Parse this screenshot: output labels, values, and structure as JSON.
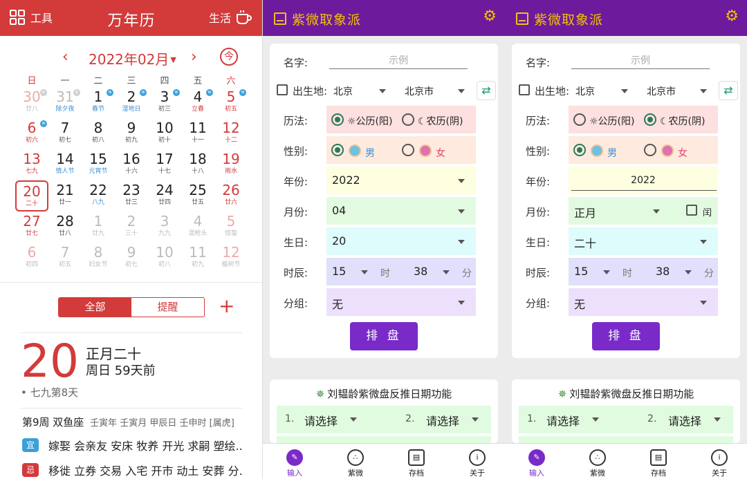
{
  "calendar": {
    "top": {
      "tool_label": "工具",
      "title": "万年历",
      "life_label": "生活"
    },
    "month_label": "2022年02月",
    "today_label": "今",
    "weekdays": [
      "日",
      "一",
      "二",
      "三",
      "四",
      "五",
      "六"
    ],
    "days": [
      {
        "n": "30",
        "l": "廿八",
        "fade": true,
        "red": true,
        "badge": "休",
        "bgrey": true
      },
      {
        "n": "31",
        "l": "除夕夜",
        "fade": true,
        "lb": true,
        "badge": "休",
        "bgrey": true
      },
      {
        "n": "1",
        "l": "春节",
        "lb": true,
        "badge": "休"
      },
      {
        "n": "2",
        "l": "湿地日",
        "lb": true,
        "badge": "休"
      },
      {
        "n": "3",
        "l": "初三",
        "badge": "休"
      },
      {
        "n": "4",
        "l": "立春",
        "lr": true,
        "badge": "休"
      },
      {
        "n": "5",
        "l": "初五",
        "red": true,
        "badge": "休"
      },
      {
        "n": "6",
        "l": "初六",
        "red": true,
        "badge": "休"
      },
      {
        "n": "7",
        "l": "初七"
      },
      {
        "n": "8",
        "l": "初八"
      },
      {
        "n": "9",
        "l": "初九"
      },
      {
        "n": "10",
        "l": "初十"
      },
      {
        "n": "11",
        "l": "十一"
      },
      {
        "n": "12",
        "l": "十二",
        "red": true
      },
      {
        "n": "13",
        "l": "七九",
        "red": true
      },
      {
        "n": "14",
        "l": "情人节",
        "lb": true
      },
      {
        "n": "15",
        "l": "元宵节",
        "lb": true
      },
      {
        "n": "16",
        "l": "十六"
      },
      {
        "n": "17",
        "l": "十七"
      },
      {
        "n": "18",
        "l": "十八"
      },
      {
        "n": "19",
        "l": "雨水",
        "red": true
      },
      {
        "n": "20",
        "l": "二十",
        "red": true,
        "sel": true
      },
      {
        "n": "21",
        "l": "廿一"
      },
      {
        "n": "22",
        "l": "八九",
        "lb": true
      },
      {
        "n": "23",
        "l": "廿三"
      },
      {
        "n": "24",
        "l": "廿四"
      },
      {
        "n": "25",
        "l": "廿五"
      },
      {
        "n": "26",
        "l": "廿六",
        "red": true
      },
      {
        "n": "27",
        "l": "廿七",
        "red": true
      },
      {
        "n": "28",
        "l": "廿八"
      },
      {
        "n": "1",
        "l": "廿九",
        "fade": true
      },
      {
        "n": "2",
        "l": "三十",
        "fade": true
      },
      {
        "n": "3",
        "l": "九九",
        "fade": true
      },
      {
        "n": "4",
        "l": "混枪头",
        "fade": true
      },
      {
        "n": "5",
        "l": "惊蛰",
        "fade": true,
        "red": true
      },
      {
        "n": "6",
        "l": "初四",
        "fade": true,
        "red": true
      },
      {
        "n": "7",
        "l": "初五",
        "fade": true
      },
      {
        "n": "8",
        "l": "妇女节",
        "fade": true
      },
      {
        "n": "9",
        "l": "初七",
        "fade": true
      },
      {
        "n": "10",
        "l": "初八",
        "fade": true
      },
      {
        "n": "11",
        "l": "初九",
        "fade": true
      },
      {
        "n": "12",
        "l": "植树节",
        "fade": true,
        "red": true
      }
    ],
    "segment": {
      "all": "全部",
      "remind": "提醒"
    },
    "plus": "+",
    "big_day": "20",
    "lunar_date": "正月二十",
    "weekday_ago": "周日 59天前",
    "jiu": "• 七九第8天",
    "week_info": "第9周 双鱼座",
    "ganzhi": "壬寅年 壬寅月 甲辰日 壬申时 [属虎]",
    "yi_tag": "宜",
    "yi_text": "嫁娶 会亲友 安床 牧养 开光 求嗣 塑绘...",
    "ji_tag": "忌",
    "ji_text": "移徙 立券 交易 入宅 开市 动土 安葬 分..."
  },
  "zw": [
    {
      "app_name": "紫微取象派",
      "gear_icon": "⚙",
      "labels": {
        "name": "名字:",
        "birthplace": "出生地:",
        "calendar": "历法:",
        "gender": "性别:",
        "year": "年份:",
        "month": "月份:",
        "day": "生日:",
        "hour": "时辰:",
        "group": "分组:"
      },
      "name_placeholder": "示例",
      "province": "北京",
      "city": "北京市",
      "solar": "☼公历(阳)",
      "lunar": "☾农历(阴)",
      "male": "男",
      "female": "女",
      "year": "2022",
      "month": "04",
      "leap": "",
      "day": "20",
      "hour": "15",
      "hour_unit": "时",
      "minute": "38",
      "minute_unit": "分",
      "group": "无",
      "submit": "排 盘",
      "reverse_title": "刘韫龄紫微盘反推日期功能",
      "pick_n1": "1.",
      "pick_s1": "请选择",
      "pick_n2": "2.",
      "pick_s2": "请选择",
      "nav": [
        "输入",
        "紫微",
        "存档",
        "关于"
      ]
    },
    {
      "app_name": "紫微取象派",
      "gear_icon": "⚙",
      "labels": {
        "name": "名字:",
        "birthplace": "出生地:",
        "calendar": "历法:",
        "gender": "性别:",
        "year": "年份:",
        "month": "月份:",
        "day": "生日:",
        "hour": "时辰:",
        "group": "分组:"
      },
      "name_placeholder": "示例",
      "province": "北京",
      "city": "北京市",
      "solar": "☼公历(阳)",
      "lunar": "☾农历(阴)",
      "male": "男",
      "female": "女",
      "year": "2022",
      "month": "正月",
      "leap": "闰",
      "day": "二十",
      "hour": "15",
      "hour_unit": "时",
      "minute": "38",
      "minute_unit": "分",
      "group": "无",
      "submit": "排 盘",
      "reverse_title": "刘韫龄紫微盘反推日期功能",
      "pick_n1": "1.",
      "pick_s1": "请选择",
      "pick_n2": "2.",
      "pick_s2": "请选择",
      "nav": [
        "输入",
        "紫微",
        "存档",
        "关于"
      ]
    }
  ],
  "colors": {
    "calendar_red": "#d33a3a",
    "app_purple": "#6e1a9c",
    "app_gold": "#f2c200",
    "button_purple": "#7a2ac8"
  }
}
